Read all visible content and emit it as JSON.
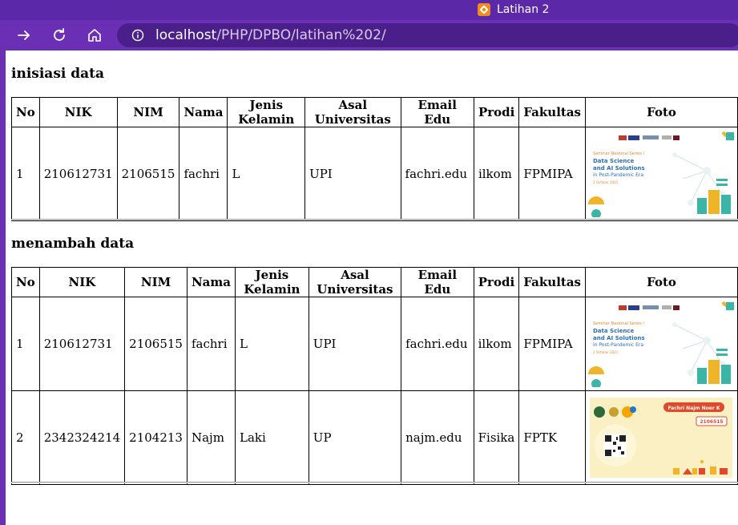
{
  "browser": {
    "tab_title": "Latihan 2",
    "url_host": "localhost",
    "url_path": "/PHP/DPBO/latihan%202/"
  },
  "section1": {
    "heading": "inisiasi data",
    "headers": [
      "No",
      "NIK",
      "NIM",
      "Nama",
      "Jenis Kelamin",
      "Asal Universitas",
      "Email Edu",
      "Prodi",
      "Fakultas",
      "Foto"
    ],
    "rows": [
      [
        "1",
        "210612731",
        "2106515",
        "fachri",
        "L",
        "UPI",
        "fachri.edu",
        "ilkom",
        "FPMIPA"
      ]
    ]
  },
  "section2": {
    "heading": "menambah data",
    "headers": [
      "No",
      "NIK",
      "NIM",
      "Nama",
      "Jenis Kelamin",
      "Asal Universitas",
      "Email Edu",
      "Prodi",
      "Fakultas",
      "Foto"
    ],
    "rows": [
      [
        "1",
        "210612731",
        "2106515",
        "fachri",
        "L",
        "UPI",
        "fachri.edu",
        "ilkom",
        "FPMIPA"
      ],
      [
        "2",
        "2342324214",
        "2104213",
        "Najm",
        "Laki",
        "UP",
        "najm.edu",
        "Fisika",
        "FPTK"
      ]
    ]
  },
  "images": {
    "seminar": {
      "series": "Seminar Nasional Series I",
      "title_line1": "Data Science",
      "title_line2": "and AI Solutions",
      "subtitle": "in Post-Pandemic Era",
      "date": "2 October 2021"
    },
    "card": {
      "name": "Fachri Najm Noer K",
      "nim": "2106515"
    }
  }
}
